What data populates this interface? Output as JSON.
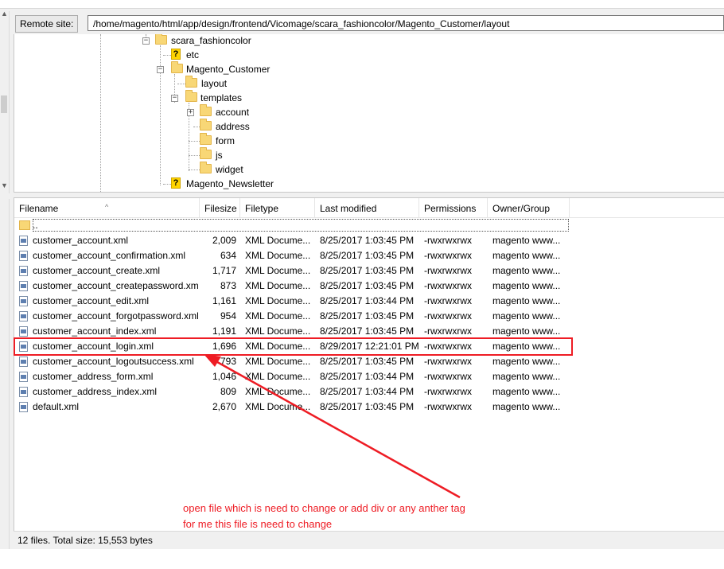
{
  "remote_site": {
    "label": "Remote site:",
    "path": "/home/magento/html/app/design/frontend/Vicomage/scara_fashioncolor/Magento_Customer/layout"
  },
  "tree": {
    "scara": "scara_fashioncolor",
    "etc": "etc",
    "customer": "Magento_Customer",
    "layout": "layout",
    "templates": "templates",
    "account": "account",
    "address": "address",
    "form": "form",
    "js": "js",
    "widget": "widget",
    "newsletter": "Magento_Newsletter"
  },
  "columns": {
    "filename": "Filename",
    "filesize": "Filesize",
    "filetype": "Filetype",
    "modified": "Last modified",
    "permissions": "Permissions",
    "owner": "Owner/Group"
  },
  "parent_dir": "..",
  "files": [
    {
      "name": "customer_account.xml",
      "size": "2,009",
      "type": "XML Docume...",
      "modified": "8/25/2017 1:03:45 PM",
      "perms": "-rwxrwxrwx",
      "owner": "magento www..."
    },
    {
      "name": "customer_account_confirmation.xml",
      "size": "634",
      "type": "XML Docume...",
      "modified": "8/25/2017 1:03:45 PM",
      "perms": "-rwxrwxrwx",
      "owner": "magento www..."
    },
    {
      "name": "customer_account_create.xml",
      "size": "1,717",
      "type": "XML Docume...",
      "modified": "8/25/2017 1:03:45 PM",
      "perms": "-rwxrwxrwx",
      "owner": "magento www..."
    },
    {
      "name": "customer_account_createpassword.xml",
      "size": "873",
      "type": "XML Docume...",
      "modified": "8/25/2017 1:03:45 PM",
      "perms": "-rwxrwxrwx",
      "owner": "magento www..."
    },
    {
      "name": "customer_account_edit.xml",
      "size": "1,161",
      "type": "XML Docume...",
      "modified": "8/25/2017 1:03:44 PM",
      "perms": "-rwxrwxrwx",
      "owner": "magento www..."
    },
    {
      "name": "customer_account_forgotpassword.xml",
      "size": "954",
      "type": "XML Docume...",
      "modified": "8/25/2017 1:03:45 PM",
      "perms": "-rwxrwxrwx",
      "owner": "magento www..."
    },
    {
      "name": "customer_account_index.xml",
      "size": "1,191",
      "type": "XML Docume...",
      "modified": "8/25/2017 1:03:45 PM",
      "perms": "-rwxrwxrwx",
      "owner": "magento www..."
    },
    {
      "name": "customer_account_login.xml",
      "size": "1,696",
      "type": "XML Docume...",
      "modified": "8/29/2017 12:21:01 PM",
      "perms": "-rwxrwxrwx",
      "owner": "magento www..."
    },
    {
      "name": "customer_account_logoutsuccess.xml",
      "size": "793",
      "type": "XML Docume...",
      "modified": "8/25/2017 1:03:45 PM",
      "perms": "-rwxrwxrwx",
      "owner": "magento www..."
    },
    {
      "name": "customer_address_form.xml",
      "size": "1,046",
      "type": "XML Docume...",
      "modified": "8/25/2017 1:03:44 PM",
      "perms": "-rwxrwxrwx",
      "owner": "magento www..."
    },
    {
      "name": "customer_address_index.xml",
      "size": "809",
      "type": "XML Docume...",
      "modified": "8/25/2017 1:03:44 PM",
      "perms": "-rwxrwxrwx",
      "owner": "magento www..."
    },
    {
      "name": "default.xml",
      "size": "2,670",
      "type": "XML Docume...",
      "modified": "8/25/2017 1:03:45 PM",
      "perms": "-rwxrwxrwx",
      "owner": "magento www..."
    }
  ],
  "annotation": {
    "line1": "open file which is need to change or add div or any anther tag",
    "line2": "for me this file is need to change",
    "color": "#ee1c24"
  },
  "status": "12 files. Total size: 15,553 bytes"
}
